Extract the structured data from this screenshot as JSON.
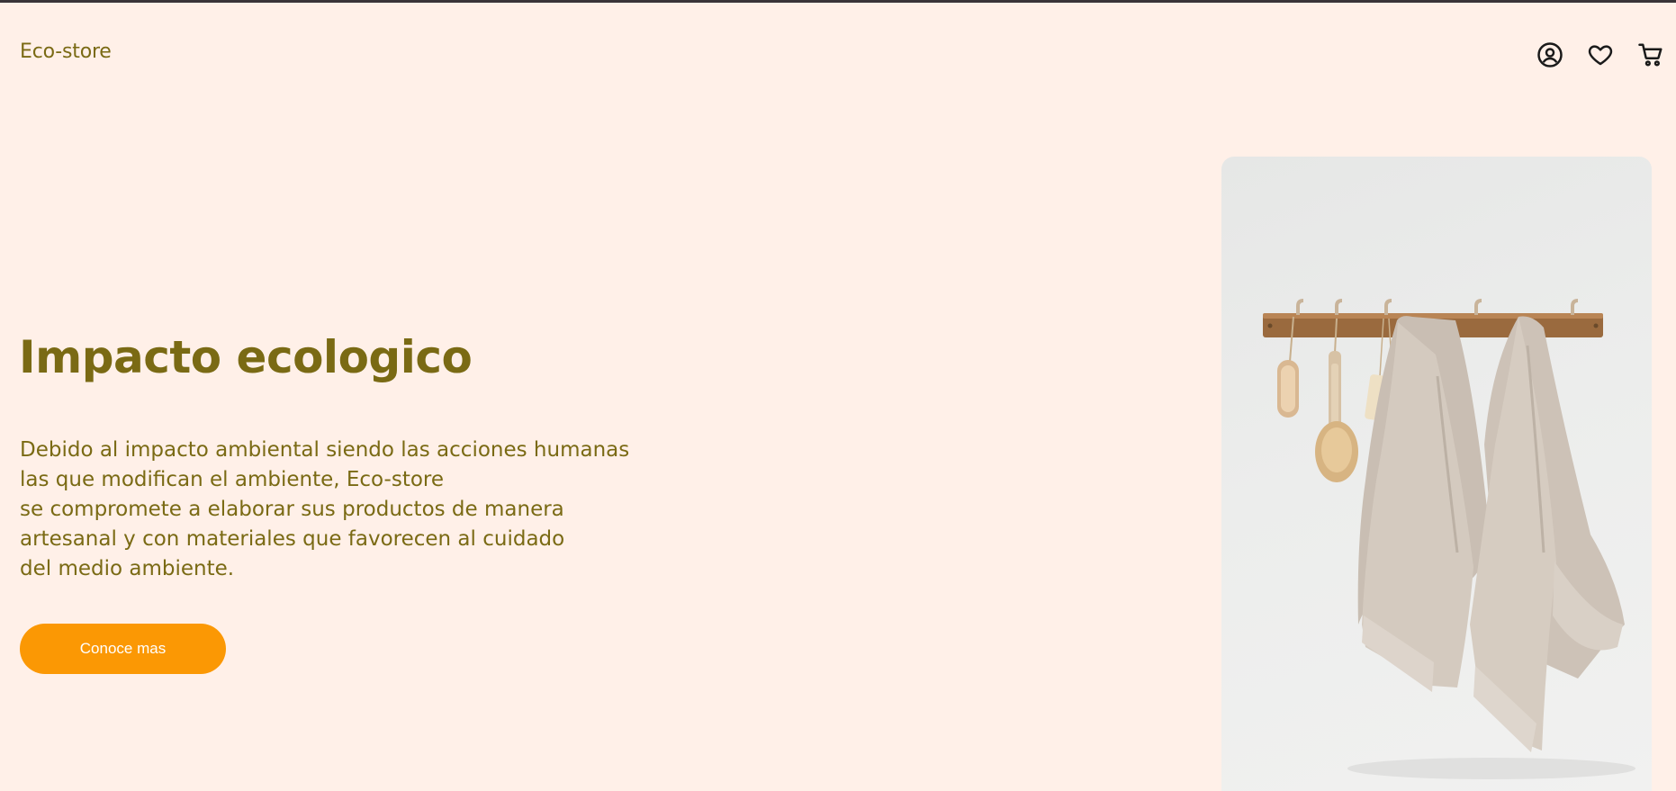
{
  "header": {
    "brand": "Eco-store",
    "icons": [
      "user-account-icon",
      "heart-icon",
      "shopping-cart-icon"
    ]
  },
  "hero": {
    "title": "Impacto ecologico",
    "paragraph_lines": [
      "Debido al impacto ambiental siendo las acciones humanas",
      "las que modifican el ambiente, Eco-store",
      "se compromete a elaborar sus productos de manera",
      "artesanal y con materiales que favorecen al cuidado",
      "del medio ambiente."
    ],
    "cta_label": "Conoce mas"
  },
  "colors": {
    "background": "#fff0e8",
    "text": "#7a6a14",
    "accent": "#fb9804",
    "icon": "#1a1a1a"
  }
}
